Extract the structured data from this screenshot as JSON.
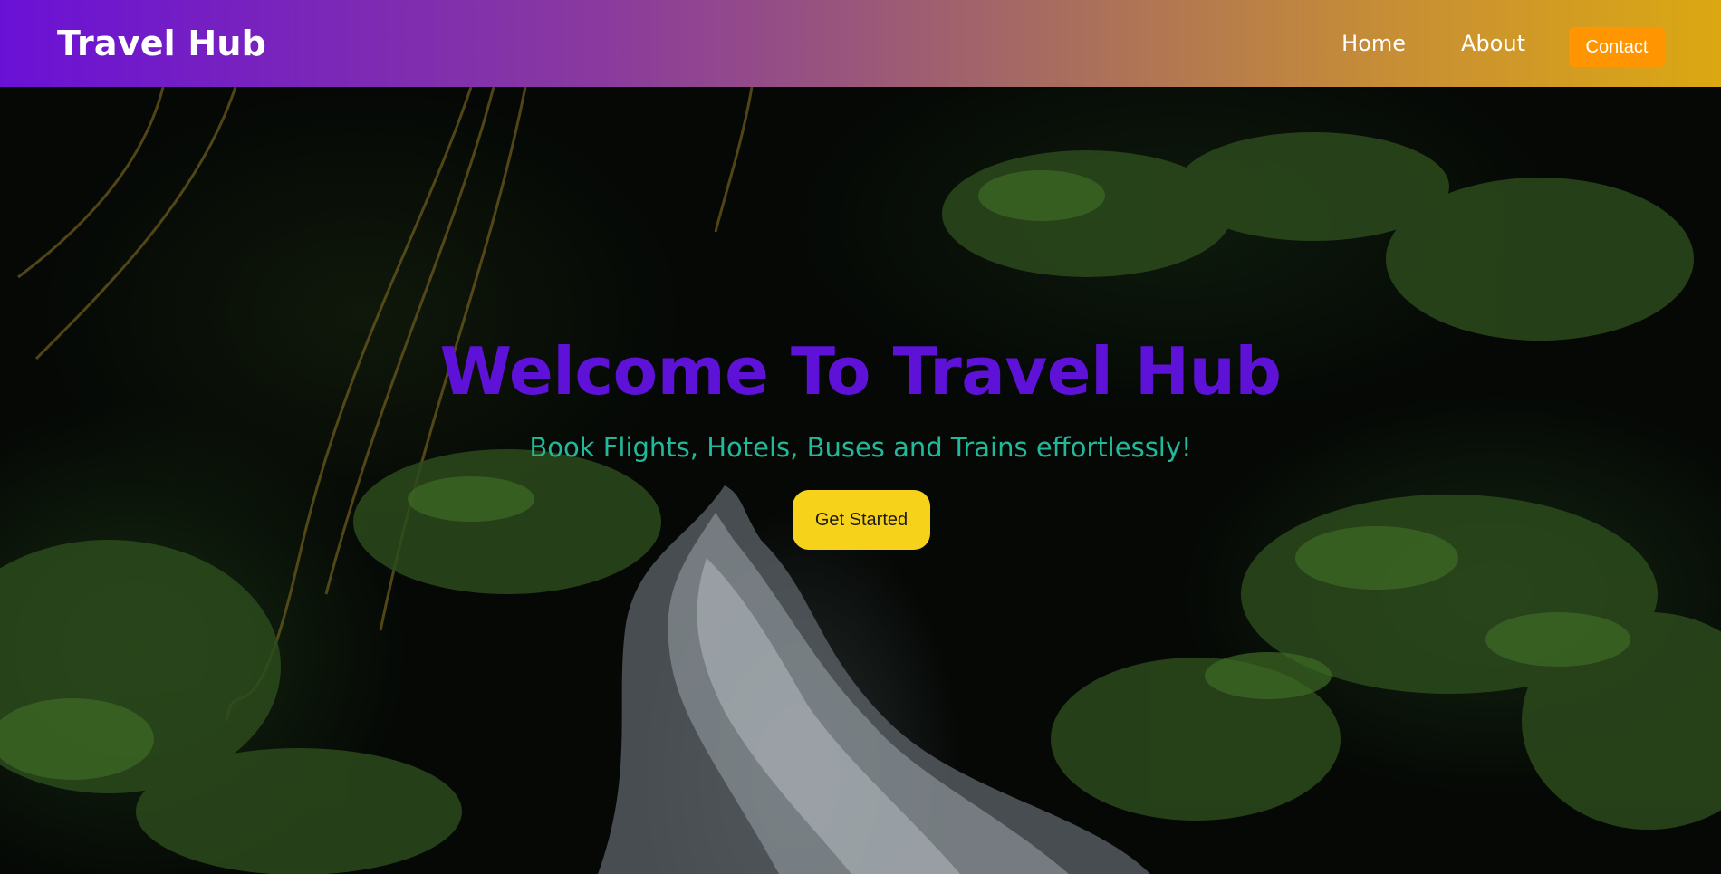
{
  "nav": {
    "brand": "Travel Hub",
    "links": [
      {
        "label": "Home"
      },
      {
        "label": "About"
      }
    ],
    "contact_label": "Contact"
  },
  "hero": {
    "title": "Welcome To Travel Hub",
    "subtitle": "Book Flights, Hotels, Buses and Trains effortlessly!",
    "cta_label": "Get Started",
    "background": "forest-waterfall-video"
  },
  "colors": {
    "nav_gradient_start": "#6a11d6",
    "nav_gradient_end": "#dba812",
    "contact_button": "#ff9500",
    "title": "#5e12d8",
    "subtitle": "#22b89a",
    "cta_button": "#f7d21a"
  }
}
